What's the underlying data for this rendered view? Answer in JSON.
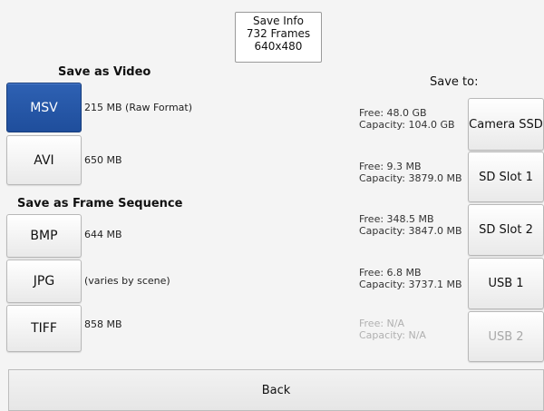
{
  "save_info": {
    "title": "Save Info",
    "frames": "732 Frames",
    "resolution": "640x480"
  },
  "video_section": {
    "heading": "Save as Video",
    "formats": [
      {
        "label": "MSV",
        "size": "215 MB (Raw Format)",
        "selected": true
      },
      {
        "label": "AVI",
        "size": "650 MB",
        "selected": false
      }
    ]
  },
  "frame_section": {
    "heading": "Save as Frame Sequence",
    "formats": [
      {
        "label": "BMP",
        "size": "644 MB"
      },
      {
        "label": "JPG",
        "size": "(varies by scene)"
      },
      {
        "label": "TIFF",
        "size": "858 MB"
      }
    ]
  },
  "destination": {
    "heading": "Save to:",
    "items": [
      {
        "label": "Camera SSD",
        "free": "Free: 48.0 GB",
        "capacity": "Capacity: 104.0 GB",
        "enabled": true
      },
      {
        "label": "SD Slot 1",
        "free": "Free: 9.3 MB",
        "capacity": "Capacity: 3879.0 MB",
        "enabled": true
      },
      {
        "label": "SD Slot 2",
        "free": "Free: 348.5 MB",
        "capacity": "Capacity: 3847.0 MB",
        "enabled": true
      },
      {
        "label": "USB 1",
        "free": "Free: 6.8 MB",
        "capacity": "Capacity: 3737.1 MB",
        "enabled": true
      },
      {
        "label": "USB 2",
        "free": "Free: N/A",
        "capacity": "Capacity: N/A",
        "enabled": false
      }
    ]
  },
  "footer": {
    "back_label": "Back"
  },
  "colors": {
    "selected": "#1f4e9c",
    "background": "#f4f4f4",
    "disabled_text": "#a8a8a8"
  }
}
